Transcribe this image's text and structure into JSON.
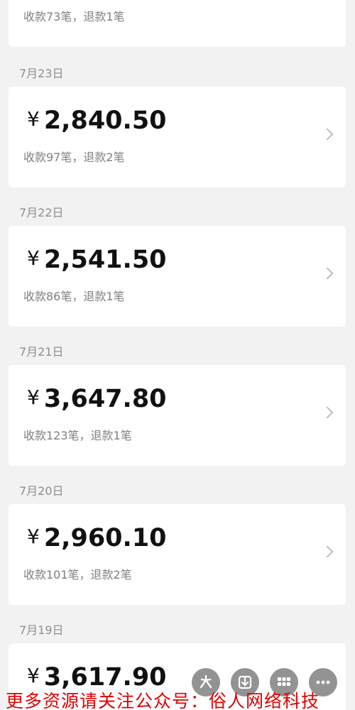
{
  "colors": {
    "background": "#f2f2f2",
    "card": "#ffffff",
    "amount": "#111111",
    "subtext": "#7f7f7f",
    "date": "#8e8e8e",
    "watermark": "#e00000"
  },
  "currency_symbol": "¥",
  "top_partial": {
    "subtitle": "收款73笔，退款1笔"
  },
  "days": [
    {
      "date": "7月23日",
      "amount": "2,840.50",
      "subtitle": "收款97笔，退款2笔"
    },
    {
      "date": "7月22日",
      "amount": "2,541.50",
      "subtitle": "收款86笔，退款1笔"
    },
    {
      "date": "7月21日",
      "amount": "3,647.80",
      "subtitle": "收款123笔，退款1笔"
    },
    {
      "date": "7月20日",
      "amount": "2,960.10",
      "subtitle": "收款101笔，退款2笔"
    },
    {
      "date": "7月19日",
      "amount": "3,617.90",
      "subtitle": ""
    }
  ],
  "floating_buttons": [
    {
      "icon": "sparkle-icon"
    },
    {
      "icon": "download-icon"
    },
    {
      "icon": "grid-icon"
    },
    {
      "icon": "more-icon"
    }
  ],
  "watermark_text": "更多资源请关注公众号：俗人网络科技"
}
